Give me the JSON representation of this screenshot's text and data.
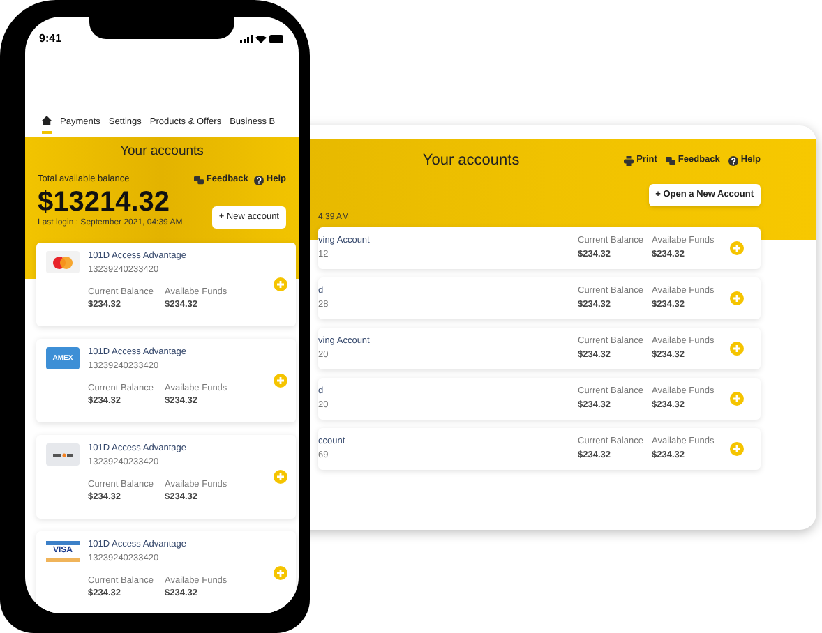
{
  "desktop": {
    "title": "Your accounts",
    "links": [
      {
        "kind": "print",
        "label": "Print"
      },
      {
        "kind": "feedback",
        "label": "Feedback"
      },
      {
        "kind": "help",
        "label": "Help"
      }
    ],
    "open_button": "+ Open a New Account",
    "last_login": "4:39 AM",
    "accounts": [
      {
        "name": "ving Account",
        "number": "12",
        "current_label": "Current Balance",
        "current": "$234.32",
        "funds_label": "Availabe Funds",
        "funds": "$234.32"
      },
      {
        "name": "d",
        "number": "28",
        "current_label": "Current Balance",
        "current": "$234.32",
        "funds_label": "Availabe Funds",
        "funds": "$234.32"
      },
      {
        "name": "ving Account",
        "number": "20",
        "current_label": "Current Balance",
        "current": "$234.32",
        "funds_label": "Availabe Funds",
        "funds": "$234.32"
      },
      {
        "name": "d",
        "number": "20",
        "current_label": "Current Balance",
        "current": "$234.32",
        "funds_label": "Availabe Funds",
        "funds": "$234.32"
      },
      {
        "name": "ccount",
        "number": "69",
        "current_label": "Current Balance",
        "current": "$234.32",
        "funds_label": "Availabe Funds",
        "funds": "$234.32"
      }
    ]
  },
  "phone": {
    "status_bar": {
      "time": "9:41"
    },
    "nav": [
      {
        "kind": "home",
        "selected": true
      },
      {
        "kind": "text",
        "label": "Payments",
        "selected": false
      },
      {
        "kind": "text",
        "label": "Settings",
        "selected": false
      },
      {
        "kind": "text",
        "label": "Products & Offers",
        "selected": false
      },
      {
        "kind": "text",
        "label": "Business B",
        "selected": false
      }
    ],
    "title": "Your accounts",
    "balance_label": "Total available balance",
    "links": [
      {
        "kind": "feedback",
        "label": "Feedback"
      },
      {
        "kind": "help",
        "label": "Help"
      }
    ],
    "balance": "$13214.32",
    "last_login": "Last login : September 2021, 04:39 AM",
    "new_button": "+ New account",
    "accounts": [
      {
        "kind": "mastercard",
        "name": "101D Access Advantage",
        "number": "13239240233420",
        "current_label": "Current Balance",
        "current": "$234.32",
        "funds_label": "Availabe Funds",
        "funds": "$234.32"
      },
      {
        "kind": "amex",
        "logo_text": "AMEX",
        "name": "101D Access Advantage",
        "number": "13239240233420",
        "current_label": "Current Balance",
        "current": "$234.32",
        "funds_label": "Availabe Funds",
        "funds": "$234.32"
      },
      {
        "kind": "discover",
        "name": "101D Access Advantage",
        "number": "13239240233420",
        "current_label": "Current Balance",
        "current": "$234.32",
        "funds_label": "Availabe Funds",
        "funds": "$234.32"
      },
      {
        "kind": "visa",
        "logo_text": "VISA",
        "name": "101D Access Advantage",
        "number": "13239240233420",
        "current_label": "Current Balance",
        "current": "$234.32",
        "funds_label": "Availabe Funds",
        "funds": "$234.32"
      }
    ]
  }
}
